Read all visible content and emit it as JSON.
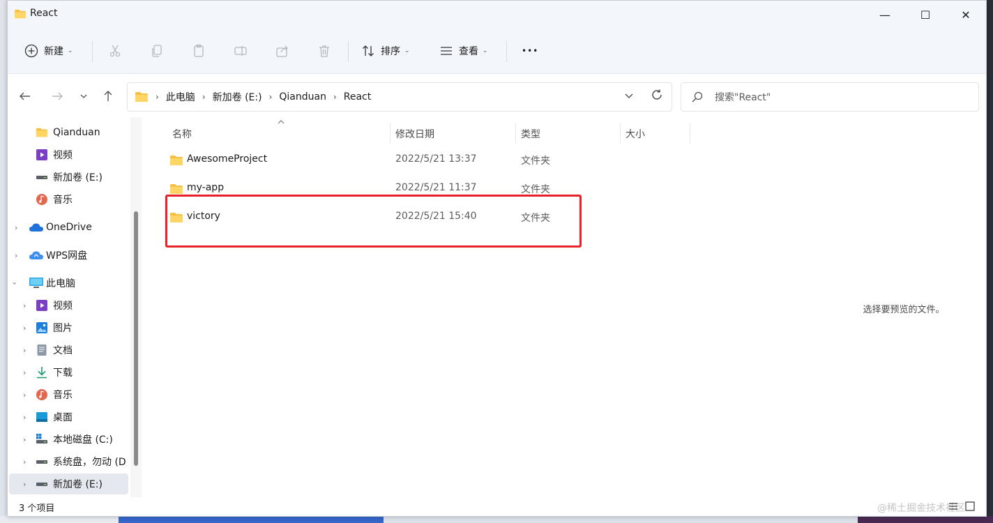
{
  "window": {
    "title": "React",
    "minimize_glyph": "—",
    "maximize_glyph": "☐",
    "close_glyph": "✕"
  },
  "toolbar": {
    "new_label": "新建",
    "sort_label": "排序",
    "view_label": "查看",
    "more_glyph": "•••",
    "caret": "⌄"
  },
  "address": {
    "crumbs": [
      "此电脑",
      "新加卷 (E:)",
      "Qianduan",
      "React"
    ],
    "separator": "›"
  },
  "search": {
    "placeholder": "搜索\"React\""
  },
  "sidebar": {
    "items": [
      {
        "label": "Qianduan",
        "icon": "folder-icon"
      },
      {
        "label": "视频",
        "icon": "video-icon"
      },
      {
        "label": "新加卷 (E:)",
        "icon": "drive-icon"
      },
      {
        "label": "音乐",
        "icon": "music-icon"
      },
      {
        "label": "OneDrive",
        "icon": "cloud-icon"
      },
      {
        "label": "WPS网盘",
        "icon": "cloud-icon"
      },
      {
        "label": "此电脑",
        "icon": "computer-icon"
      },
      {
        "label": "视频",
        "icon": "video-icon"
      },
      {
        "label": "图片",
        "icon": "pictures-icon"
      },
      {
        "label": "文档",
        "icon": "document-icon"
      },
      {
        "label": "下载",
        "icon": "download-icon"
      },
      {
        "label": "音乐",
        "icon": "music-icon"
      },
      {
        "label": "桌面",
        "icon": "desktop-icon"
      },
      {
        "label": "本地磁盘 (C:)",
        "icon": "windows-drive-icon"
      },
      {
        "label": "系统盘，勿动 (D",
        "icon": "drive-icon"
      },
      {
        "label": "新加卷 (E:)",
        "icon": "drive-icon"
      }
    ]
  },
  "columns": {
    "name": "名称",
    "date": "修改日期",
    "type": "类型",
    "size": "大小"
  },
  "files": [
    {
      "name": "AwesomeProject",
      "date": "2022/5/21 13:37",
      "type": "文件夹"
    },
    {
      "name": "my-app",
      "date": "2022/5/21 11:37",
      "type": "文件夹"
    },
    {
      "name": "victory",
      "date": "2022/5/21 15:40",
      "type": "文件夹"
    }
  ],
  "preview": {
    "message": "选择要预览的文件。"
  },
  "status": {
    "count": "3 个项目",
    "watermark": "@稀土掘金技术社区"
  },
  "colors": {
    "folder": "#f5c043",
    "highlight": "#e8202a",
    "accent": "#0067c0"
  }
}
